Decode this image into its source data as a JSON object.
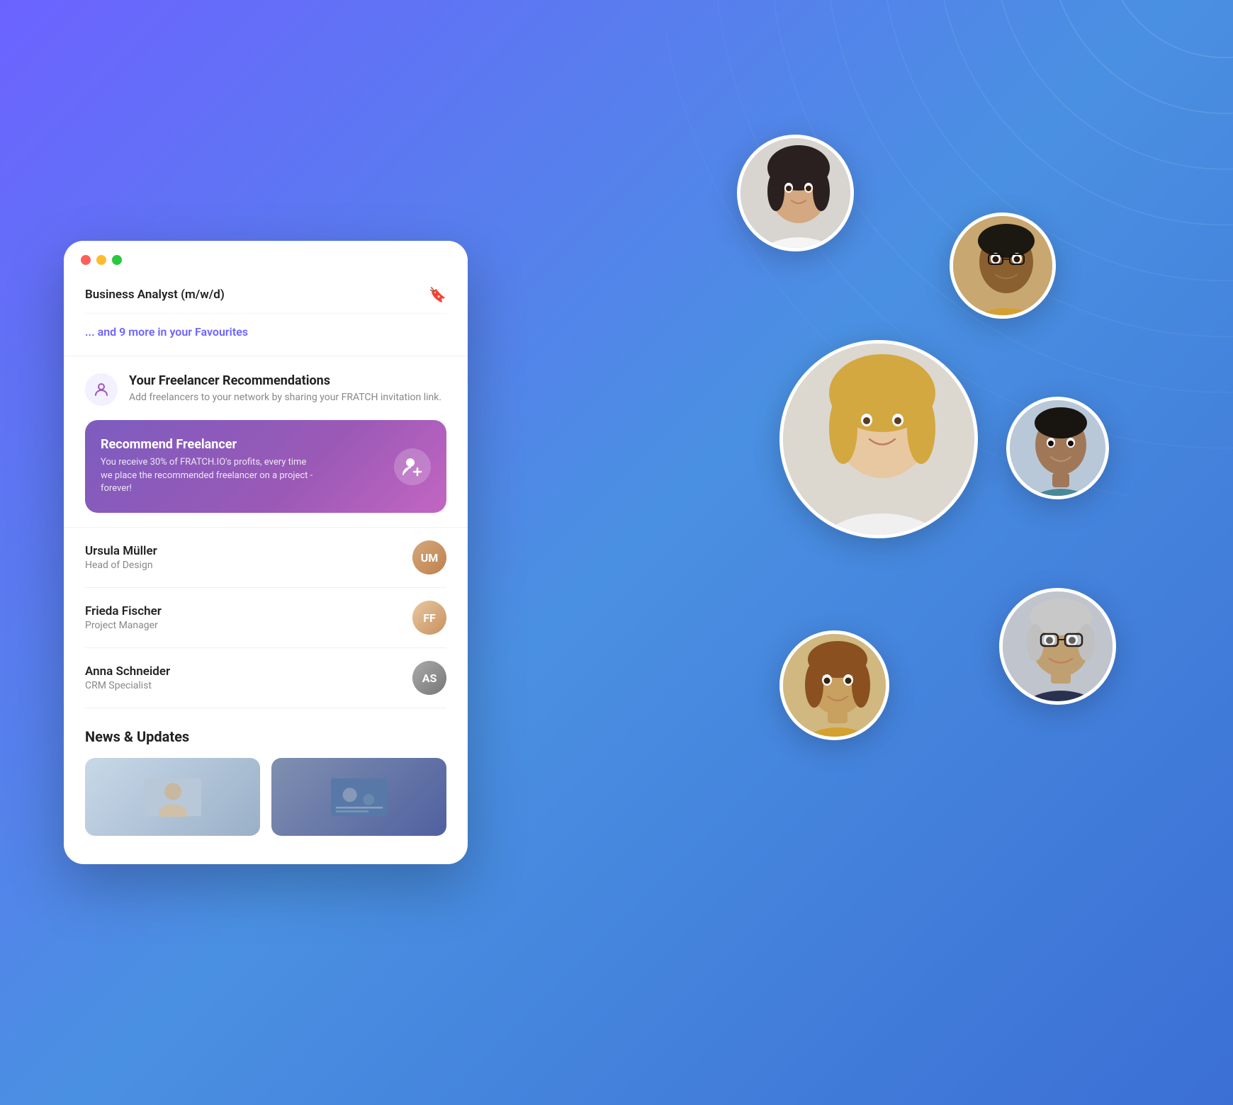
{
  "window": {
    "dots": [
      "red",
      "yellow",
      "green"
    ]
  },
  "job_item": {
    "title": "Business Analyst (m/w/d)"
  },
  "favourites": {
    "more_text": "... and 9 more in your ",
    "link_text": "Favourites"
  },
  "recommendations": {
    "title": "Your Freelancer Recommendations",
    "subtitle": "Add freelancers to your network by sharing your FRATCH invitation link."
  },
  "banner": {
    "title": "Recommend Freelancer",
    "description": "You receive 30% of FRATCH.IO's profits, every time we place the recommended freelancer on a project - forever!"
  },
  "freelancers": [
    {
      "name": "Ursula Müller",
      "role": "Head of Design",
      "initials": "UM"
    },
    {
      "name": "Frieda Fischer",
      "role": "Project Manager",
      "initials": "FF"
    },
    {
      "name": "Anna Schneider",
      "role": "CRM Specialist",
      "initials": "AS"
    }
  ],
  "news": {
    "title": "News & Updates"
  },
  "people": [
    {
      "label": "Woman smiling",
      "position": "topleft"
    },
    {
      "label": "Man with glasses",
      "position": "topright"
    },
    {
      "label": "Woman blonde center",
      "position": "center"
    },
    {
      "label": "Man casual",
      "position": "midright"
    },
    {
      "label": "Older man glasses",
      "position": "botright"
    },
    {
      "label": "Young woman bottom",
      "position": "bottom"
    }
  ]
}
